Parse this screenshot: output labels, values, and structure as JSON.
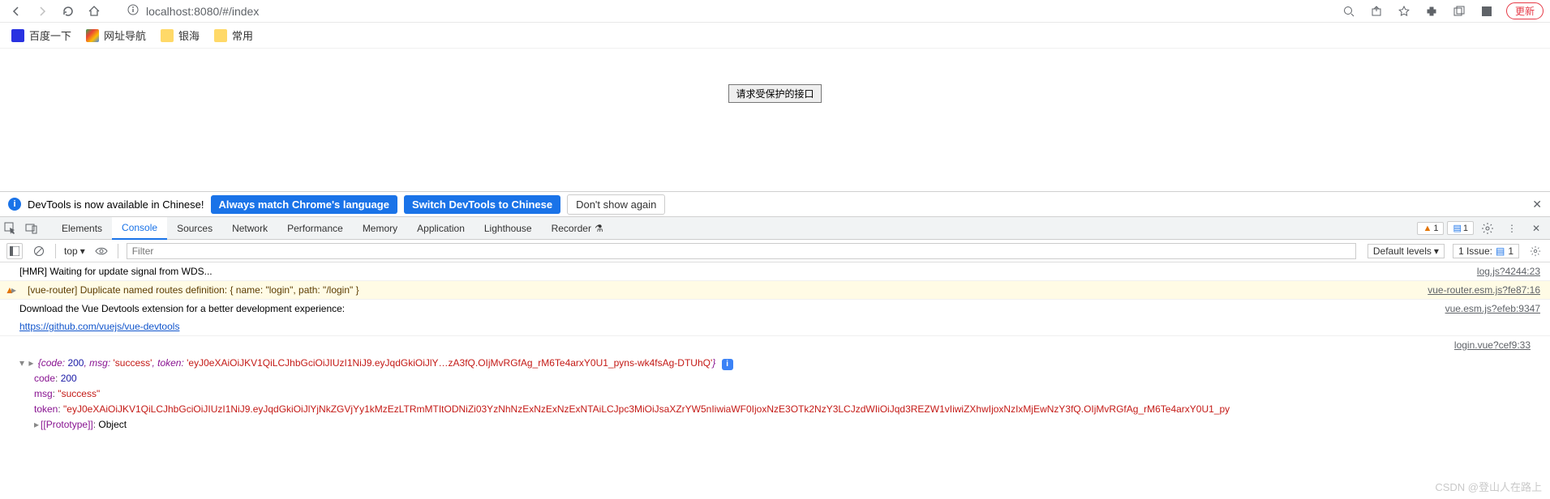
{
  "browser": {
    "url": "localhost:8080/#/index",
    "update_label": "更新"
  },
  "bookmarks": {
    "baidu": "百度一下",
    "hao": "网址导航",
    "yinhai": "银海",
    "changyong": "常用"
  },
  "page": {
    "button_label": "请求受保护的接口"
  },
  "infobar": {
    "message": "DevTools is now available in Chinese!",
    "btn_always": "Always match Chrome's language",
    "btn_switch": "Switch DevTools to Chinese",
    "btn_dont": "Don't show again"
  },
  "devtools": {
    "tabs": {
      "elements": "Elements",
      "console": "Console",
      "sources": "Sources",
      "network": "Network",
      "performance": "Performance",
      "memory": "Memory",
      "application": "Application",
      "lighthouse": "Lighthouse",
      "recorder": "Recorder"
    },
    "warn_count": "1",
    "msg_count": "1"
  },
  "console_toolbar": {
    "context": "top",
    "filter_placeholder": "Filter",
    "levels": "Default levels",
    "issue_label": "1 Issue:",
    "issue_count": "1"
  },
  "console": {
    "row1_text": "[HMR] Waiting for update signal from WDS...",
    "row1_src": "log.js?4244:23",
    "row2_text": "[vue-router] Duplicate named routes definition: { name: \"login\", path: \"/login\" }",
    "row2_src": "vue-router.esm.js?fe87:16",
    "row3_text": "Download the Vue Devtools extension for a better development experience:",
    "row3_link": "https://github.com/vuejs/vue-devtools",
    "row3_src": "vue.esm.js?efeb:9347",
    "row4_src": "login.vue?cef9:33",
    "obj_summary_prefix": "{code: ",
    "obj_code": "200",
    "obj_msg_label": ", msg: ",
    "obj_msg_val": "'success'",
    "obj_token_label": ", token: ",
    "obj_token_short": "'eyJ0eXAiOiJKV1QiLCJhbGciOiJIUzI1NiJ9.eyJqdGkiOiJlY…zA3fQ.OIjMvRGfAg_rM6Te4arxY0U1_pyns-wk4fsAg-DTUhQ'",
    "obj_close": "}",
    "prop_code_key": "code",
    "prop_code_val": "200",
    "prop_msg_key": "msg",
    "prop_msg_val": "\"success\"",
    "prop_token_key": "token",
    "prop_token_val": "\"eyJ0eXAiOiJKV1QiLCJhbGciOiJIUzI1NiJ9.eyJqdGkiOiJlYjNkZGVjYy1kMzEzLTRmMTItODNiZi03YzNhNzExNzExNzExNTAiLCJpc3MiOiJsaXZrYW5nIiwiaWF0IjoxNzE3OTk2NzY3LCJzdWIiOiJqd3REZW1vIiwiZXhwIjoxNzIxMjEwNzY3fQ.OIjMvRGfAg_rM6Te4arxY0U1_py",
    "proto_key": "[[Prototype]]",
    "proto_val": "Object"
  },
  "watermark": "CSDN @登山人在路上"
}
